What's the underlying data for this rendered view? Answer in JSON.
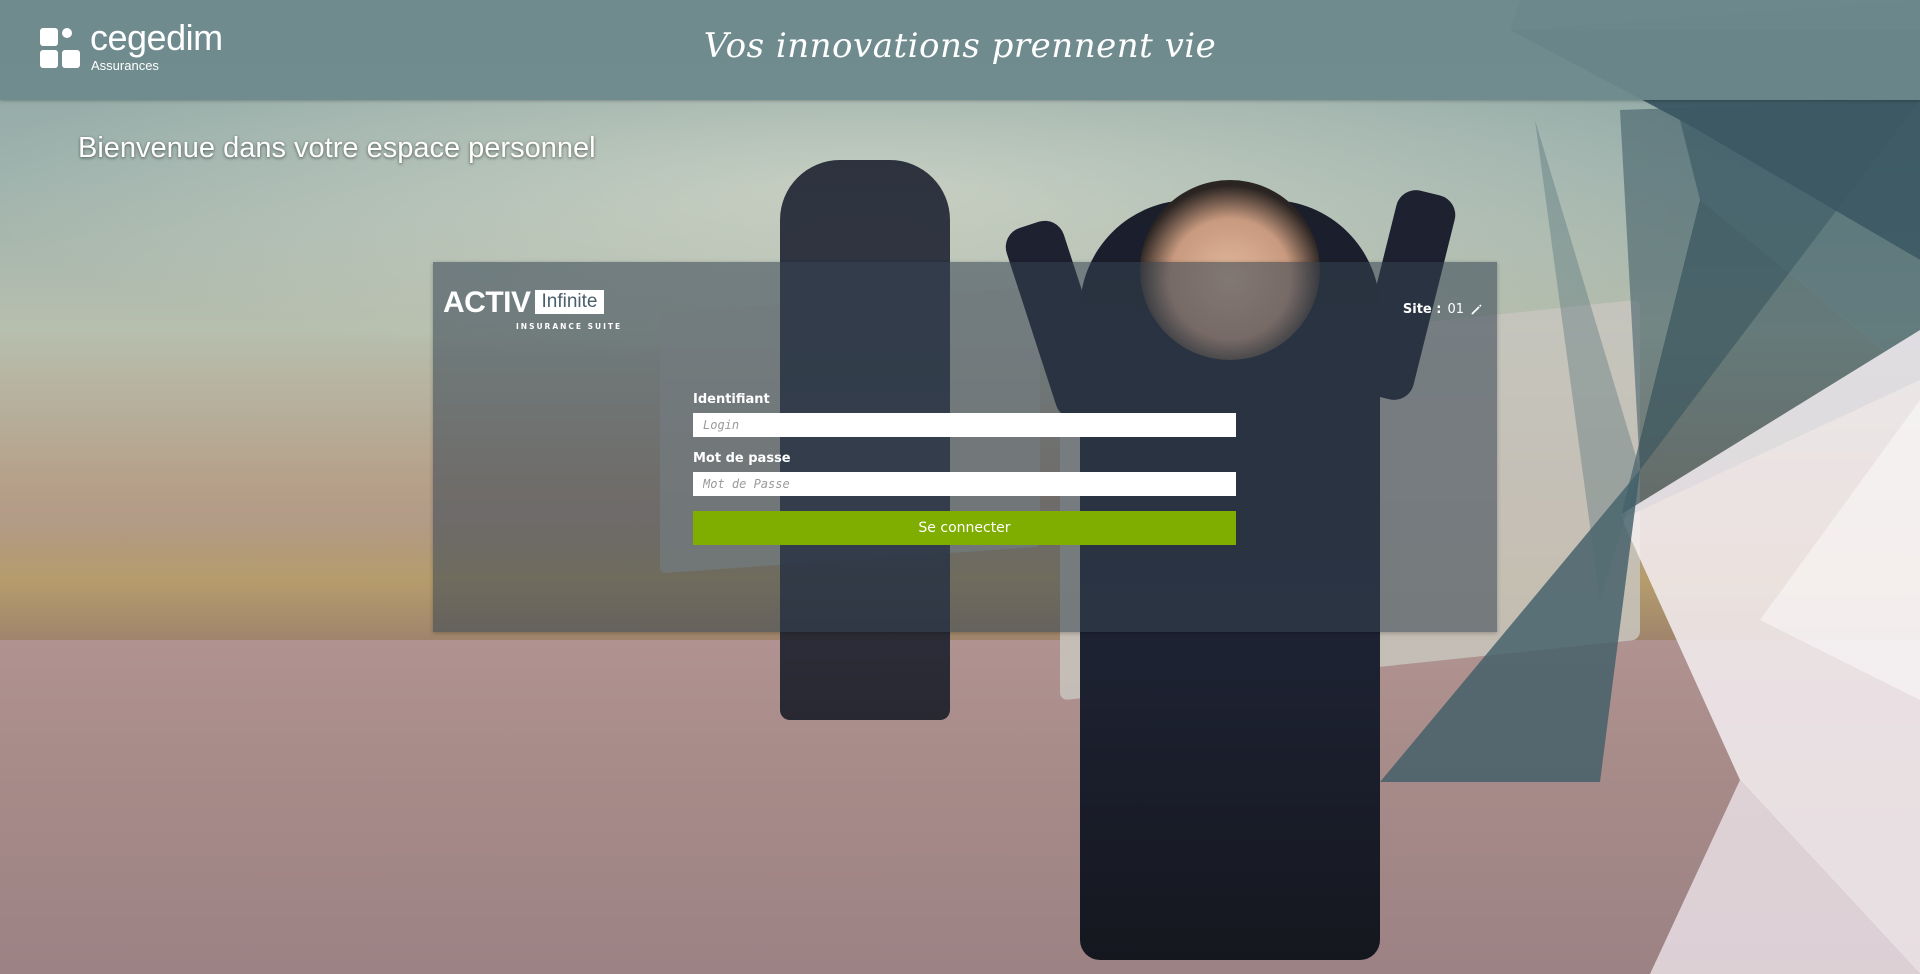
{
  "header": {
    "brand_name": "cegedim",
    "brand_sub": "Assurances",
    "tagline": "Vos innovations prennent vie"
  },
  "welcome": "Bienvenue dans votre espace personnel",
  "login_panel": {
    "product_word": "ACTIV",
    "product_badge": "Infinite",
    "product_suite": "INSURANCE SUITE",
    "site_label": "Site :",
    "site_value": "01",
    "username_label": "Identifiant",
    "username_placeholder": "Login",
    "username_value": "",
    "password_label": "Mot de passe",
    "password_placeholder": "Mot de Passe",
    "password_value": "",
    "submit_label": "Se connecter"
  },
  "colors": {
    "header_bg": "#6c898c",
    "accent_green": "#7fae00",
    "panel_bg": "#344452",
    "text_white": "#ffffff"
  },
  "icons": {
    "logo_mark": "cegedim-logo-icon",
    "edit_site": "pencil-icon"
  }
}
